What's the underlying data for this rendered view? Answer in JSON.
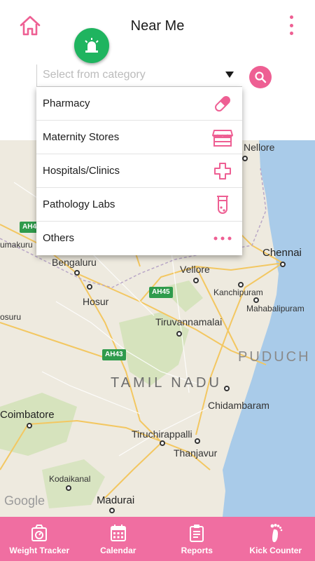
{
  "header": {
    "title": "Near Me",
    "home_icon": "home-icon",
    "menu_icon": "overflow-menu-icon",
    "emergency_icon": "siren-icon"
  },
  "search": {
    "placeholder": "Select from category",
    "button_icon": "search-icon"
  },
  "categories": [
    {
      "label": "Pharmacy",
      "icon": "pill-icon"
    },
    {
      "label": "Maternity Stores",
      "icon": "store-icon"
    },
    {
      "label": "Hospitals/Clinics",
      "icon": "cross-icon"
    },
    {
      "label": "Pathology Labs",
      "icon": "test-tube-icon"
    },
    {
      "label": "Others",
      "icon": "more-dots-icon"
    }
  ],
  "map": {
    "labels": {
      "nellore": "Nellore",
      "chennai": "Chennai",
      "bengaluru": "Bengaluru",
      "vellore": "Vellore",
      "hosur": "Hosur",
      "kanchipuram": "Kanchipuram",
      "mahabalipuram": "Mahabalipuram",
      "tiruvannamalai": "Tiruvannamalai",
      "puduch": "PUDUCH",
      "tamil_nadu": "TAMIL NADU",
      "coimbatore": "Coimbatore",
      "chidambaram": "Chidambaram",
      "tiruchirappalli": "Tiruchirappalli",
      "thanjavur": "Thanjavur",
      "kodaikanal": "Kodaikanal",
      "madurai": "Madurai",
      "tumakuru": "umakuru",
      "hosur_left": "osuru"
    },
    "shields": {
      "ah4": "AH4",
      "ah45": "AH45",
      "ah43": "AH43"
    },
    "attribution": "Google"
  },
  "bottom_nav": [
    {
      "label": "Weight Tracker",
      "icon": "scale-icon"
    },
    {
      "label": "Calendar",
      "icon": "calendar-icon"
    },
    {
      "label": "Reports",
      "icon": "clipboard-icon"
    },
    {
      "label": "Kick Counter",
      "icon": "footprint-icon"
    }
  ],
  "colors": {
    "accent": "#ee5f93",
    "nav_bg": "#f06ea1",
    "emergency": "#1fb45f",
    "sea": "#a9cbe9",
    "land": "#eeeadf",
    "forest": "#cfe1b4"
  }
}
